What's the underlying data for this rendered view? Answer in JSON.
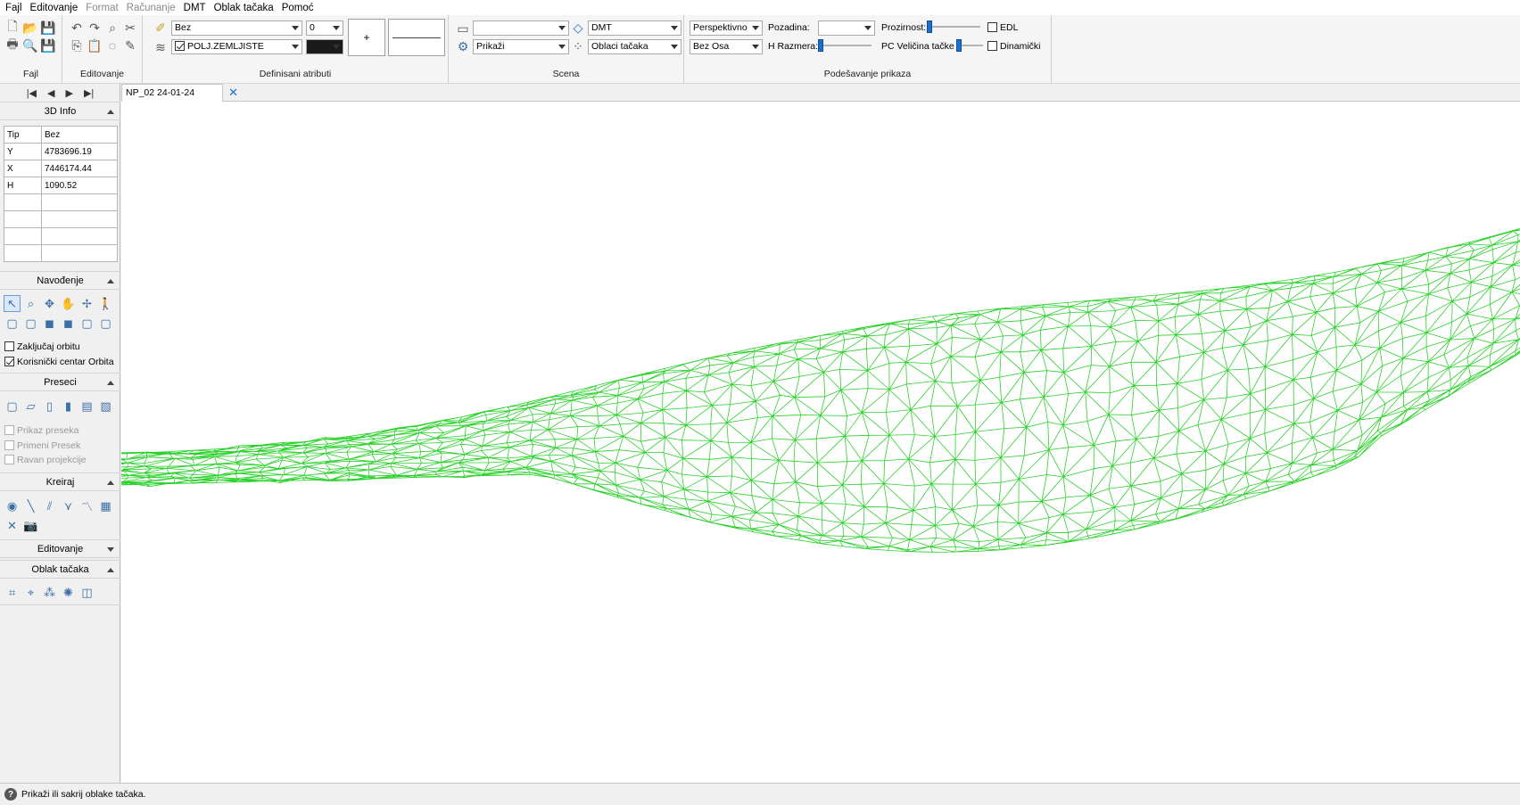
{
  "menu": [
    {
      "label": "Fajl",
      "disabled": false
    },
    {
      "label": "Editovanje",
      "disabled": false
    },
    {
      "label": "Format",
      "disabled": true
    },
    {
      "label": "Računanje",
      "disabled": true
    },
    {
      "label": "DMT",
      "disabled": false
    },
    {
      "label": "Oblak tačaka",
      "disabled": false
    },
    {
      "label": "Pomoć",
      "disabled": false
    }
  ],
  "ribbon": {
    "groups": {
      "fajl": "Fajl",
      "editovanje": "Editovanje",
      "atributi": "Definisani atributi",
      "scena": "Scena",
      "prikaz": "Podešavanje prikaza"
    },
    "atributi": {
      "layer": "Bez",
      "layer_num": "0",
      "feature": "POLJ.ZEMLJISTE",
      "plus": "+"
    },
    "scena": {
      "combo1": "",
      "combo2": "Prikaži",
      "dmt": "DMT",
      "oblaci": "Oblaci tačaka"
    },
    "prikaz": {
      "projection": "Perspektivno",
      "axes": "Bez Osa",
      "pozadina_label": "Pozadina:",
      "pozadina_value": "",
      "h_razmera_label": "H Razmera:",
      "prozirnost_label": "Prozirnost:",
      "pc_velicina_label": "PC Veličina tačke",
      "edl_label": "EDL",
      "dinamicki_label": "Dinamički"
    }
  },
  "left_panel": {
    "info_title": "3D Info",
    "info_rows": [
      {
        "key": "Tip",
        "value": "Bez"
      },
      {
        "key": "Y",
        "value": "4783696.19"
      },
      {
        "key": "X",
        "value": "7446174.44"
      },
      {
        "key": "H",
        "value": "1090.52"
      },
      {
        "key": "",
        "value": ""
      },
      {
        "key": "",
        "value": ""
      },
      {
        "key": "",
        "value": ""
      },
      {
        "key": "",
        "value": ""
      }
    ],
    "navodjenje_title": "Navođenje",
    "zakljucaj": "Zaključaj orbitu",
    "korisnicki": "Korisnički centar Orbita",
    "preseci_title": "Preseci",
    "prikaz_preseka": "Prikaz preseka",
    "primeni_presek": "Primeni Presek",
    "ravan_projekcije": "Ravan projekcije",
    "kreiraj_title": "Kreiraj",
    "editovanje_title": "Editovanje",
    "oblak_title": "Oblak tačaka"
  },
  "tab": {
    "label": "NP_02 24-01-24"
  },
  "status": {
    "text": "Prikaži ili sakrij oblake tačaka."
  },
  "colors": {
    "mesh": "#2bd12b",
    "slider": "#1e6fd0"
  },
  "icons": {
    "nav_first": "skip-first-icon",
    "nav_prev": "prev-icon",
    "nav_next": "next-icon",
    "nav_last": "skip-last-icon"
  }
}
